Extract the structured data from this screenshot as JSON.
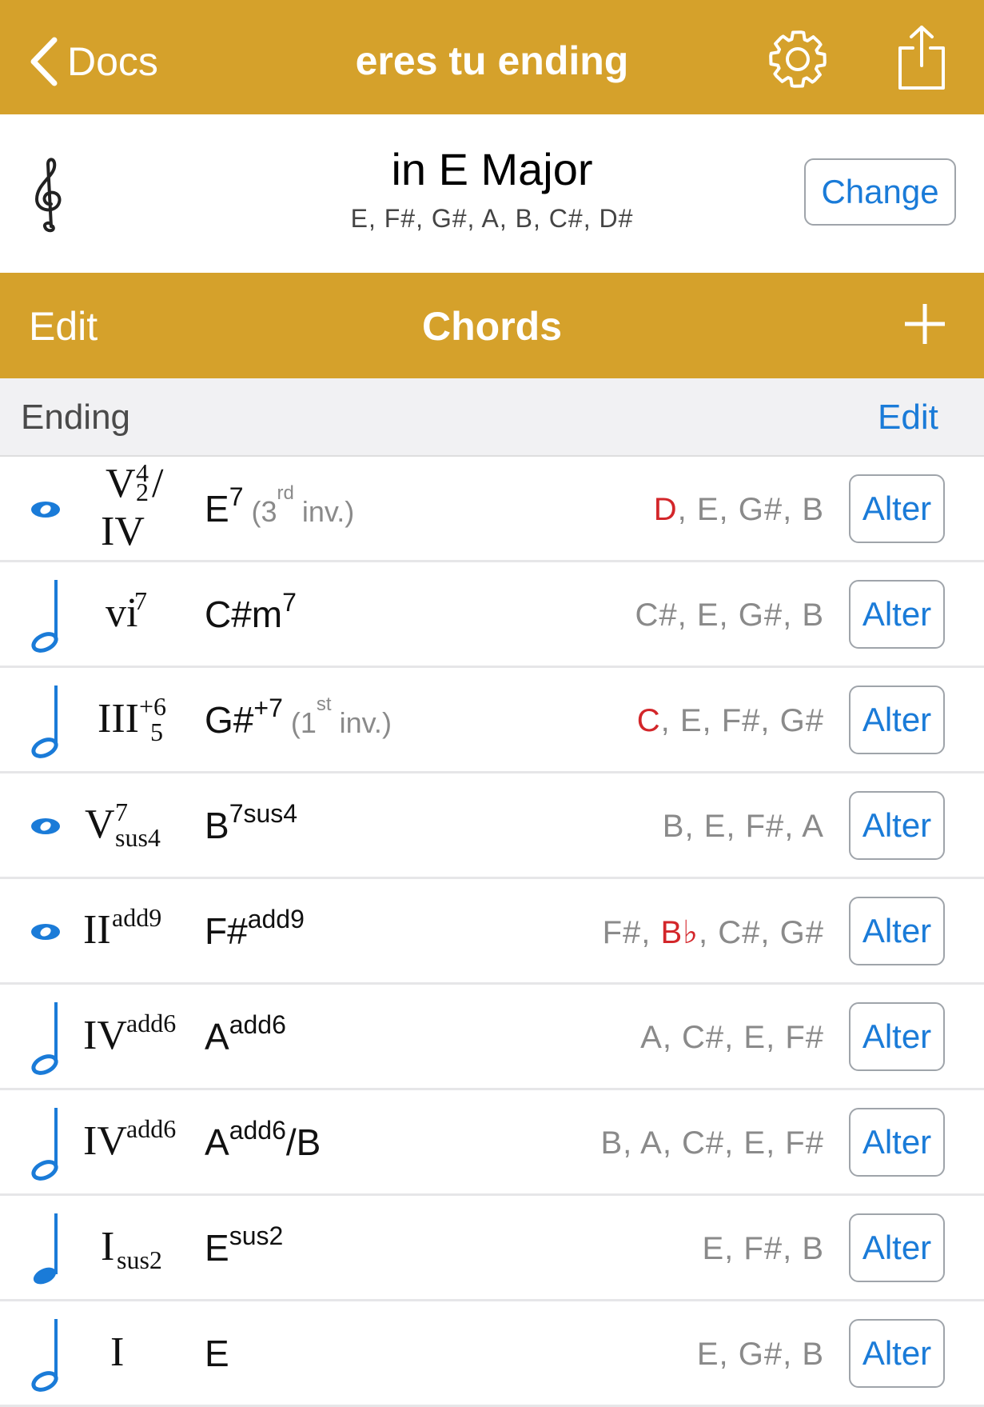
{
  "navbar": {
    "back_label": "Docs",
    "title": "eres tu ending",
    "settings_icon": "gear-icon",
    "share_icon": "share-icon"
  },
  "key": {
    "clef_icon": "treble-clef-icon",
    "title": "in E Major",
    "notes": "E, F#, G#, A, B, C#, D#",
    "change_label": "Change"
  },
  "chords_bar": {
    "edit_label": "Edit",
    "title": "Chords",
    "add_icon": "plus-icon"
  },
  "section": {
    "title": "Ending",
    "edit_label": "Edit"
  },
  "rows": [
    {
      "duration": "whole",
      "roman": {
        "main": "V",
        "sup": "4",
        "sub": "2",
        "slash": "/",
        "second_line": "IV"
      },
      "chord": {
        "root": "E",
        "sup": "7",
        "inv_num": "3",
        "inv_ord": "rd",
        "inv_word": "inv."
      },
      "notes": [
        {
          "t": "D",
          "red": true
        },
        {
          "t": ", E, G#, B"
        }
      ],
      "alter_label": "Alter"
    },
    {
      "duration": "half",
      "roman": {
        "main": "vi",
        "sup": "7"
      },
      "chord": {
        "root": "C#m",
        "sup": "7"
      },
      "notes": [
        {
          "t": "C#, E, G#, B"
        }
      ],
      "alter_label": "Alter"
    },
    {
      "duration": "half",
      "roman": {
        "main": "III",
        "sup": "+6",
        "sub": "5"
      },
      "chord": {
        "root": "G#",
        "sup": "+7",
        "inv_num": "1",
        "inv_ord": "st",
        "inv_word": "inv."
      },
      "notes": [
        {
          "t": "C",
          "red": true
        },
        {
          "t": ", E, F#, G#"
        }
      ],
      "alter_label": "Alter"
    },
    {
      "duration": "whole",
      "roman": {
        "main": "V",
        "sup": "7",
        "sub": "sus4"
      },
      "chord": {
        "root": "B",
        "sup": "7sus4"
      },
      "notes": [
        {
          "t": "B, E, F#, A"
        }
      ],
      "alter_label": "Alter"
    },
    {
      "duration": "whole",
      "roman": {
        "main": "II",
        "sup": "add9"
      },
      "chord": {
        "root": "F#",
        "sup": "add9"
      },
      "notes": [
        {
          "t": "F#, "
        },
        {
          "t": "B♭",
          "red": true
        },
        {
          "t": ", C#, G#"
        }
      ],
      "alter_label": "Alter"
    },
    {
      "duration": "half",
      "roman": {
        "main": "IV",
        "sup": "add6"
      },
      "chord": {
        "root": "A",
        "sup": "add6"
      },
      "notes": [
        {
          "t": "A, C#, E, F#"
        }
      ],
      "alter_label": "Alter"
    },
    {
      "duration": "half",
      "roman": {
        "main": "IV",
        "sup": "add6"
      },
      "chord": {
        "root": "A",
        "sup": "add6",
        "tail": "/B"
      },
      "notes": [
        {
          "t": "B, A, C#, E, F#"
        }
      ],
      "alter_label": "Alter"
    },
    {
      "duration": "quarter",
      "roman": {
        "main": "I",
        "sub": "sus2"
      },
      "chord": {
        "root": "E",
        "sup": "sus2"
      },
      "notes": [
        {
          "t": "E, F#, B"
        }
      ],
      "alter_label": "Alter"
    },
    {
      "duration": "half",
      "roman": {
        "main": "I"
      },
      "chord": {
        "root": "E"
      },
      "notes": [
        {
          "t": "E, G#, B"
        }
      ],
      "alter_label": "Alter"
    }
  ],
  "colors": {
    "header": "#d5a12b",
    "accent": "#1a7bd8",
    "wrong_note": "#d3262a",
    "note_icon": "#1a7bd8"
  }
}
